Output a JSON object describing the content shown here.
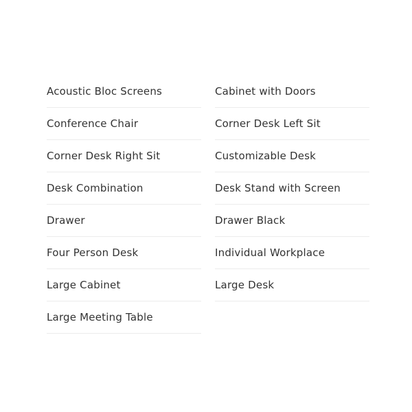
{
  "products": [
    "Acoustic Bloc Screens",
    "Cabinet with Doors",
    "Conference Chair",
    "Corner Desk Left Sit",
    "Corner Desk Right Sit",
    "Customizable Desk",
    "Desk Combination",
    "Desk Stand with Screen",
    "Drawer",
    "Drawer Black",
    "Four Person Desk",
    "Individual Workplace",
    "Large Cabinet",
    "Large Desk",
    "Large Meeting Table"
  ]
}
